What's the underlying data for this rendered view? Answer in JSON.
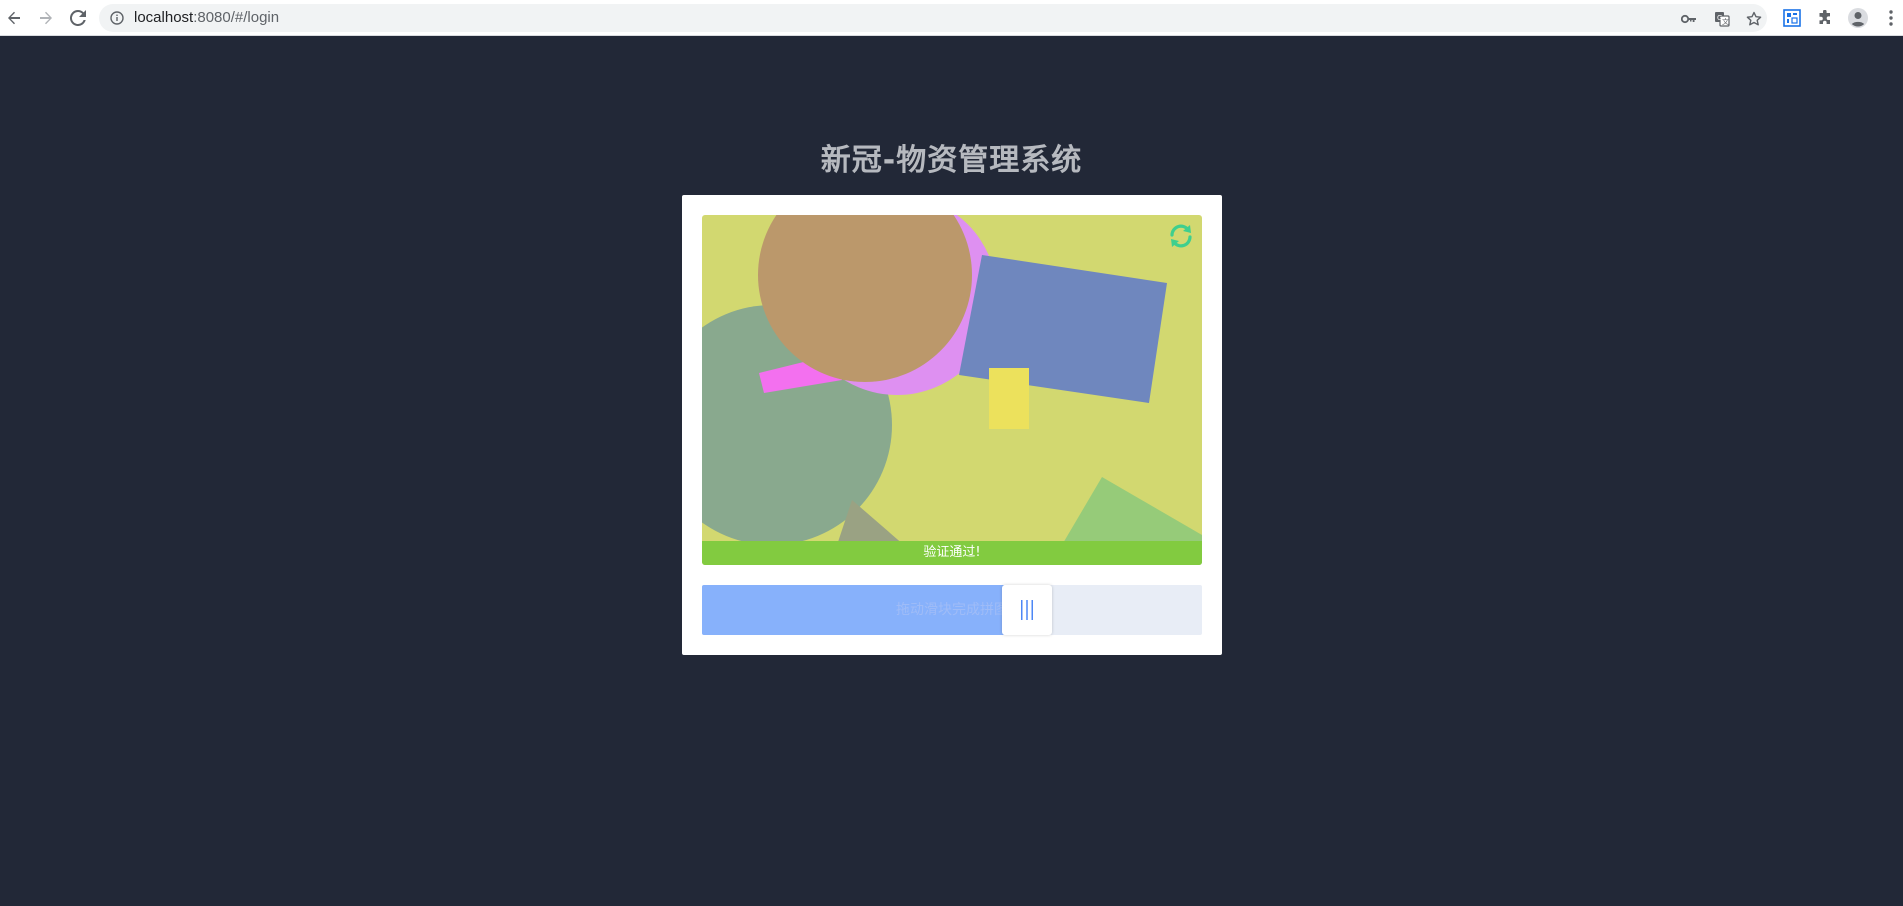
{
  "browser": {
    "url_host": "localhost",
    "url_rest": ":8080/#/login",
    "icons": [
      "back-icon",
      "forward-icon",
      "reload-icon",
      "site-info-icon",
      "key-icon",
      "translate-icon",
      "star-icon",
      "extension-qr-icon",
      "extensions-puzzle-icon",
      "profile-avatar-icon",
      "menu-kebab-icon"
    ]
  },
  "page": {
    "title": "新冠-物资管理系统"
  },
  "captcha": {
    "success_text": "验证通过!",
    "slider_hint": "拖动滑块完成拼图",
    "slider_progress": 0.6,
    "refresh_icon": "refresh-icon",
    "handle_icon": "grip-lines-icon"
  },
  "colors": {
    "page_background": "#222837",
    "title_color": "#b6b9bf",
    "success_green": "#82cb40",
    "slider_fill": "#87b1fb",
    "slider_track": "#e8edf6",
    "refresh_green": "#3fcf8e"
  }
}
